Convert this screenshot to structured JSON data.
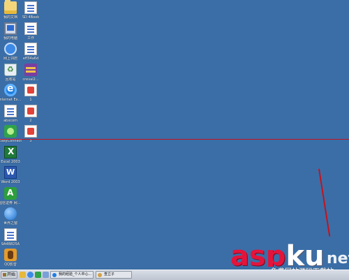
{
  "desktop": {
    "icons_col1": [
      {
        "label": "我的文档",
        "icon": "folder-icon"
      },
      {
        "label": "我的电脑",
        "icon": "computer-icon"
      },
      {
        "label": "网上邻居",
        "icon": "network-icon"
      },
      {
        "label": "回收站",
        "icon": "recycle-bin-icon"
      },
      {
        "label": "Internet Explorer",
        "icon": "ie-icon"
      },
      {
        "label": "abxcom",
        "icon": "doc-icon"
      },
      {
        "label": "EasyConnect",
        "icon": "green-app-icon"
      },
      {
        "label": "Excel 2003",
        "icon": "excel-icon"
      },
      {
        "label": "Word 2003",
        "icon": "word-icon"
      },
      {
        "label": "国信证券 网上交易",
        "icon": "app-icon"
      },
      {
        "label": "世界之窗",
        "icon": "globe-icon"
      },
      {
        "label": "9A4B825A",
        "icon": "doc-icon"
      },
      {
        "label": "QQ影音",
        "icon": "orange-app-icon"
      }
    ],
    "icons_col2": [
      {
        "label": "SD 4Book",
        "icon": "doc-icon"
      },
      {
        "label": "工作",
        "icon": "doc-icon"
      },
      {
        "label": "eff34a6d",
        "icon": "doc-icon"
      },
      {
        "label": "creval2...",
        "icon": "winrar-icon"
      },
      {
        "label": "1",
        "icon": "pdf-icon"
      },
      {
        "label": "2",
        "icon": "pdf-icon"
      },
      {
        "label": "3",
        "icon": "pdf-icon"
      }
    ]
  },
  "watermark": {
    "asp": "asp",
    "ku": "ku",
    "net": "net",
    "tagline": "免费网站源码下载站"
  },
  "taskbar": {
    "start_label": "开始",
    "tasks": [
      {
        "label": "我的经验_个人中心...",
        "icon": "ie-icon"
      },
      {
        "label": "查立子",
        "icon": "user-icon"
      }
    ]
  }
}
